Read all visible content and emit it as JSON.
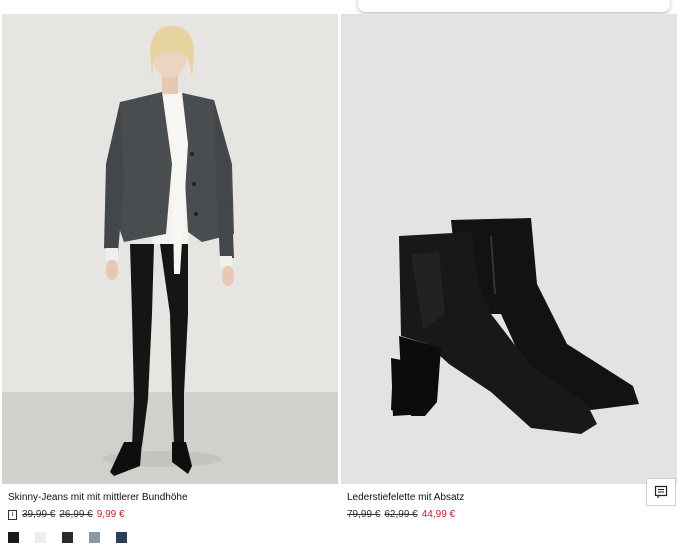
{
  "products": [
    {
      "name": "Skinny-Jeans mit mit mittlerer Bundhöhe",
      "info_icon": "info-icon",
      "prices": [
        "39,99 €",
        "26,99 €"
      ],
      "sale_price": "9,99 €",
      "swatches": [
        "#1a1a1a",
        "#eeeeee",
        "#2a2a2a",
        "#8798a6",
        "#2a3f57"
      ]
    },
    {
      "name": "Lederstiefelette mit Absatz",
      "prices": [
        "79,99 €",
        "62,99 €"
      ],
      "sale_price": "44,99 €"
    }
  ],
  "colors": {
    "sale": "#c0232c",
    "image_bg_1": "#e6e4e1",
    "image_bg_2": "#e3e3e3"
  },
  "chat_button": {
    "icon": "chat-icon"
  }
}
